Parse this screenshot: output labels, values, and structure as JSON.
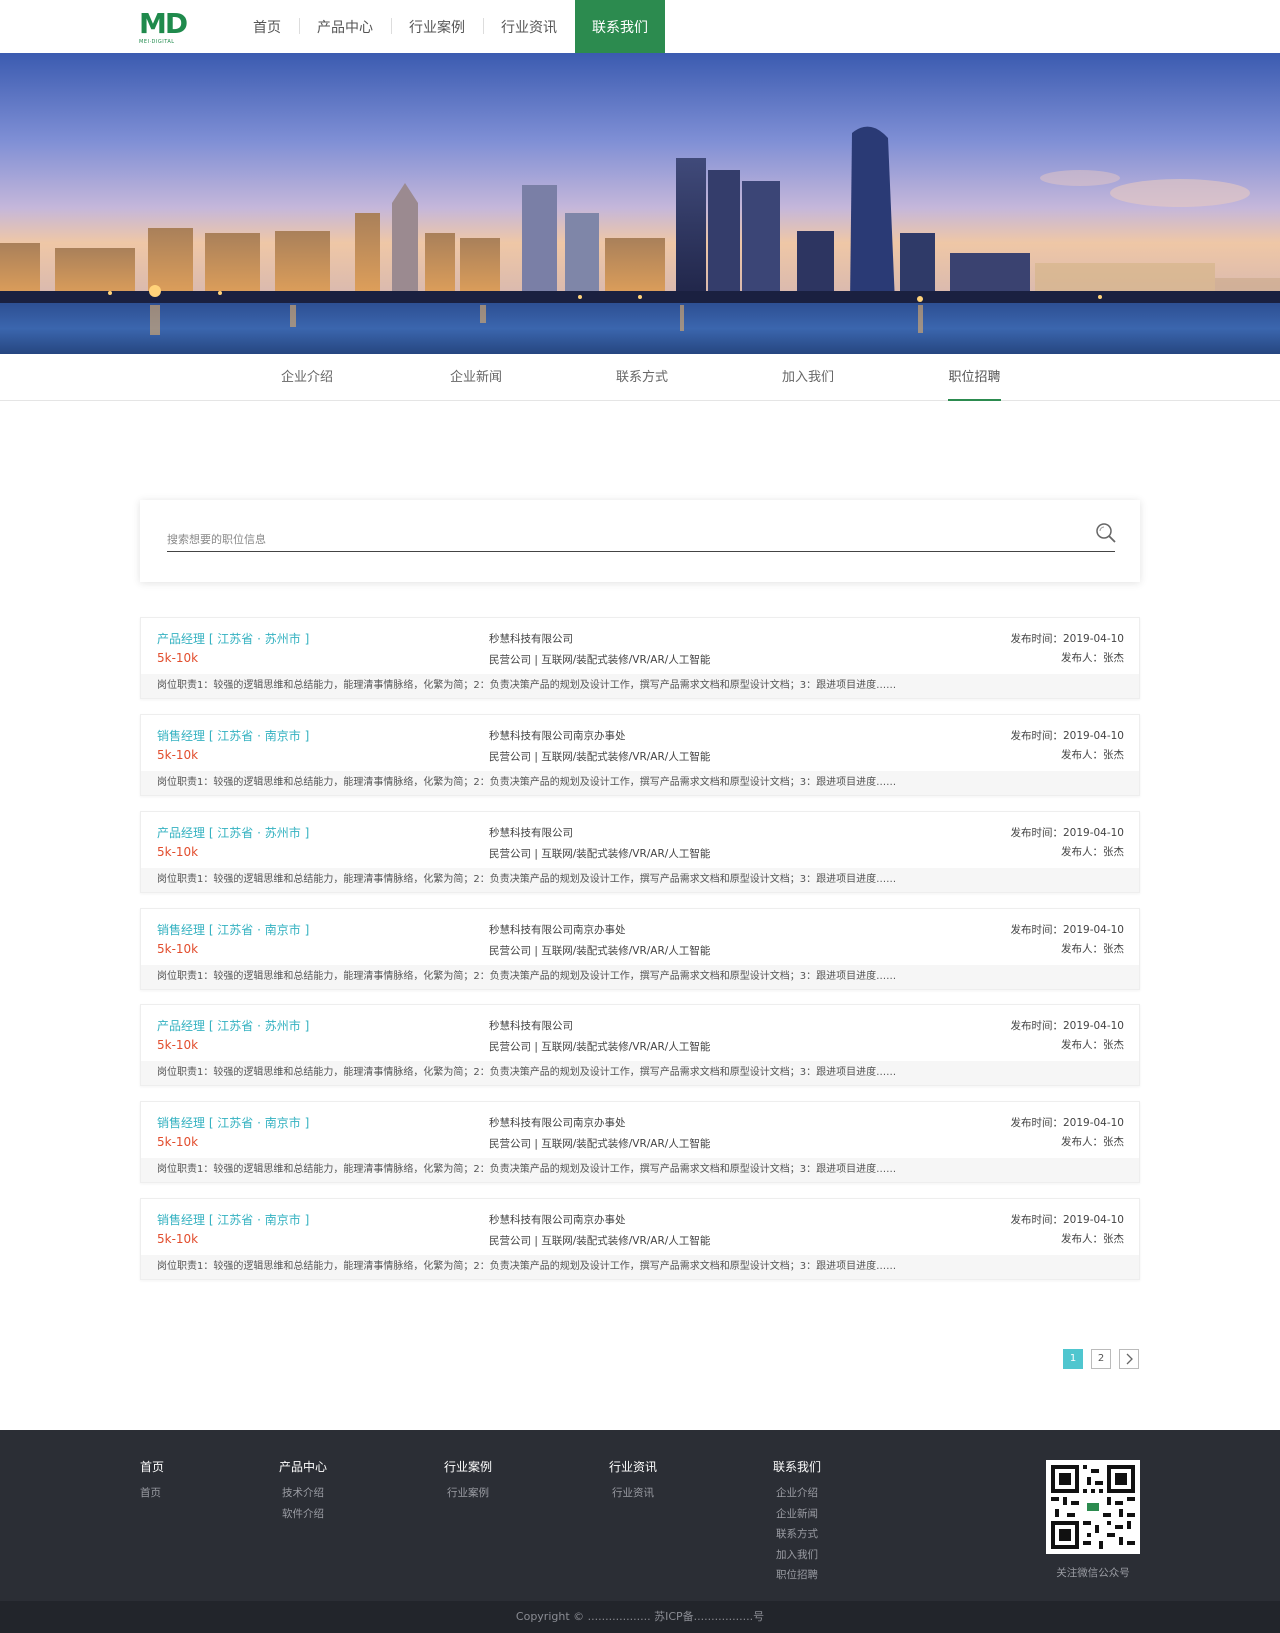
{
  "header": {
    "logo_text": "MD",
    "logo_sub": "MEI·DIGITAL",
    "nav": [
      {
        "label": "首页"
      },
      {
        "label": "产品中心"
      },
      {
        "label": "行业案例"
      },
      {
        "label": "行业资讯"
      },
      {
        "label": "联系我们"
      }
    ]
  },
  "subnav": [
    {
      "label": "企业介绍"
    },
    {
      "label": "企业新闻"
    },
    {
      "label": "联系方式"
    },
    {
      "label": "加入我们"
    },
    {
      "label": "职位招聘"
    }
  ],
  "search": {
    "placeholder": "搜索想要的职位信息"
  },
  "jobs": [
    {
      "title": "产品经理 [ 江苏省 · 苏州市 ]",
      "salary": "5k-10k",
      "company": "秒慧科技有限公司",
      "tags": "民营公司 | 互联网/装配式装修/VR/AR/人工智能",
      "date": "发布时间：2019-04-10",
      "publisher": "发布人：张杰",
      "desc": "岗位职责1：较强的逻辑思维和总结能力，能理清事情脉络，化繁为简；2：负责决策产品的规划及设计工作，撰写产品需求文档和原型设计文档；3：跟进项目进度……"
    },
    {
      "title": "销售经理 [ 江苏省 · 南京市 ]",
      "salary": "5k-10k",
      "company": "秒慧科技有限公司南京办事处",
      "tags": "民营公司 | 互联网/装配式装修/VR/AR/人工智能",
      "date": "发布时间：2019-04-10",
      "publisher": "发布人：张杰",
      "desc": "岗位职责1：较强的逻辑思维和总结能力，能理清事情脉络，化繁为简；2：负责决策产品的规划及设计工作，撰写产品需求文档和原型设计文档；3：跟进项目进度……"
    },
    {
      "title": "产品经理 [ 江苏省 · 苏州市 ]",
      "salary": "5k-10k",
      "company": "秒慧科技有限公司",
      "tags": "民营公司 | 互联网/装配式装修/VR/AR/人工智能",
      "date": "发布时间：2019-04-10",
      "publisher": "发布人：张杰",
      "desc": "岗位职责1：较强的逻辑思维和总结能力，能理清事情脉络，化繁为简；2：负责决策产品的规划及设计工作，撰写产品需求文档和原型设计文档；3：跟进项目进度……"
    },
    {
      "title": "销售经理 [ 江苏省 · 南京市 ]",
      "salary": "5k-10k",
      "company": "秒慧科技有限公司南京办事处",
      "tags": "民营公司 | 互联网/装配式装修/VR/AR/人工智能",
      "date": "发布时间：2019-04-10",
      "publisher": "发布人：张杰",
      "desc": "岗位职责1：较强的逻辑思维和总结能力，能理清事情脉络，化繁为简；2：负责决策产品的规划及设计工作，撰写产品需求文档和原型设计文档；3：跟进项目进度……"
    },
    {
      "title": "产品经理 [ 江苏省 · 苏州市 ]",
      "salary": "5k-10k",
      "company": "秒慧科技有限公司",
      "tags": "民营公司 | 互联网/装配式装修/VR/AR/人工智能",
      "date": "发布时间：2019-04-10",
      "publisher": "发布人：张杰",
      "desc": "岗位职责1：较强的逻辑思维和总结能力，能理清事情脉络，化繁为简；2：负责决策产品的规划及设计工作，撰写产品需求文档和原型设计文档；3：跟进项目进度……"
    },
    {
      "title": "销售经理 [ 江苏省 · 南京市 ]",
      "salary": "5k-10k",
      "company": "秒慧科技有限公司南京办事处",
      "tags": "民营公司 | 互联网/装配式装修/VR/AR/人工智能",
      "date": "发布时间：2019-04-10",
      "publisher": "发布人：张杰",
      "desc": "岗位职责1：较强的逻辑思维和总结能力，能理清事情脉络，化繁为简；2：负责决策产品的规划及设计工作，撰写产品需求文档和原型设计文档；3：跟进项目进度……"
    },
    {
      "title": "销售经理 [ 江苏省 · 南京市 ]",
      "salary": "5k-10k",
      "company": "秒慧科技有限公司南京办事处",
      "tags": "民营公司 | 互联网/装配式装修/VR/AR/人工智能",
      "date": "发布时间：2019-04-10",
      "publisher": "发布人：张杰",
      "desc": "岗位职责1：较强的逻辑思维和总结能力，能理清事情脉络，化繁为简；2：负责决策产品的规划及设计工作，撰写产品需求文档和原型设计文档；3：跟进项目进度……"
    }
  ],
  "pagination": {
    "pages": [
      "1",
      "2"
    ],
    "current": "1",
    "next_icon": "chevron-right-icon"
  },
  "footer": {
    "columns": [
      {
        "head": "首页",
        "links": [
          "首页"
        ]
      },
      {
        "head": "产品中心",
        "links": [
          "技术介绍",
          "软件介绍"
        ]
      },
      {
        "head": "行业案例",
        "links": [
          "行业案例"
        ]
      },
      {
        "head": "行业资讯",
        "links": [
          "行业资讯"
        ]
      },
      {
        "head": "联系我们",
        "links": [
          "企业介绍",
          "企业新闻",
          "联系方式",
          "加入我们",
          "职位招聘"
        ]
      }
    ],
    "qr_caption": "关注微信公众号",
    "copyright": "Copyright © .................. 苏ICP备.................号"
  },
  "colors": {
    "brand_green": "#2c8b4f",
    "job_title": "#35b2c1",
    "salary": "#e24e2e",
    "footer_bg": "#2b2e35",
    "pager_active": "#4fc6cf"
  }
}
